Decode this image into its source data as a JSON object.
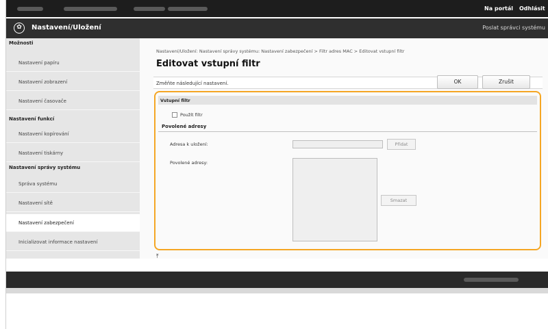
{
  "header": {
    "portal_link": "Na portál",
    "logout_link": "Odhlásit"
  },
  "titlebar": {
    "app_title": "Nastavení/Uložení",
    "send_link": "Poslat správci systému"
  },
  "sidebar": {
    "options_heading": "Možnosti",
    "options_items": [
      "Nastavení papíru",
      "Nastavení zobrazení",
      "Nastavení časovače"
    ],
    "function_heading": "Nastavení funkcí",
    "function_items": [
      "Nastavení kopírování",
      "Nastavení tiskárny"
    ],
    "admin_heading": "Nastavení správy systému",
    "admin_items": [
      "Správa systému",
      "Nastavení sítě",
      "Nastavení zabezpečení",
      "Inicializovat informace nastavení"
    ],
    "active_item": "Nastavení zabezpečení"
  },
  "main": {
    "breadcrumb": "Nastavení/Uložení: Nastavení správy systému: Nastavení zabezpečení > Filtr adres MAC > Editovat vstupní filtr",
    "page_title": "Editovat vstupní filtr",
    "instruction": "Změňte následující nastavení.",
    "ok_label": "OK",
    "cancel_label": "Zrušit"
  },
  "form": {
    "section_title": "Vstupní filtr",
    "use_filter_label": "Použít filtr",
    "use_filter_checked": false,
    "allowed_section_title": "Povolené adresy",
    "address_to_save_label": "Adresa k uložení:",
    "address_to_save_value": "",
    "add_button": "Přidat",
    "allowed_addresses_label": "Povolené adresy:",
    "allowed_addresses": [],
    "delete_button": "Smazat"
  },
  "colors": {
    "highlight": "#f5a623",
    "topbar": "#1d1d1d",
    "titlebar": "#2f2f2f"
  }
}
